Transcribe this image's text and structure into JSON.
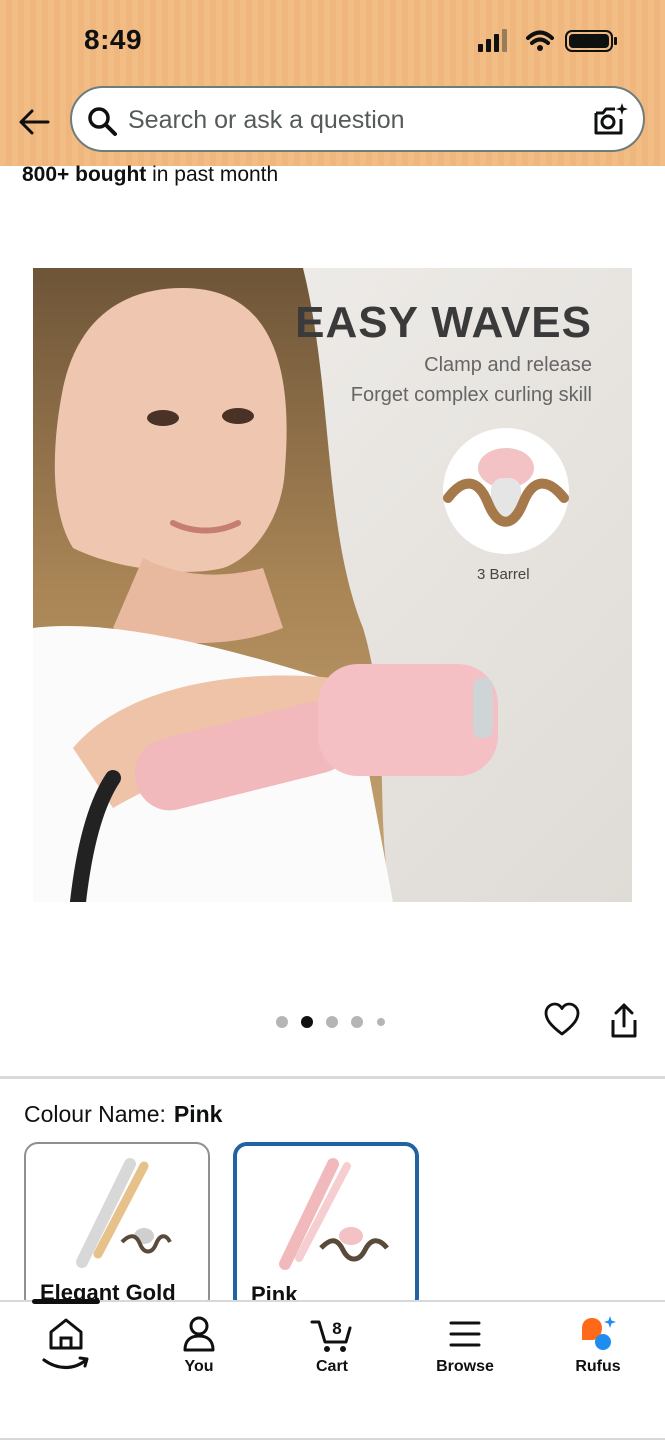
{
  "status_bar": {
    "time": "8:49"
  },
  "search": {
    "placeholder": "Search or ask a question"
  },
  "product": {
    "bought_count": "800+ bought",
    "bought_suffix": "in past month",
    "image": {
      "title": "EASY WAVES",
      "subtitle_1": "Clamp and release",
      "subtitle_2": "Forget complex curling skill",
      "badge": "3 Barrel"
    },
    "carousel": {
      "total": 5,
      "active_index": 1
    }
  },
  "colour": {
    "label": "Colour Name:",
    "selected": "Pink",
    "options": [
      {
        "name": "Elegant Gold",
        "selected": false
      },
      {
        "name": "Pink",
        "selected": true
      }
    ]
  },
  "bottom_nav": {
    "items": [
      {
        "label": "",
        "icon": "home-icon"
      },
      {
        "label": "You",
        "icon": "person-icon"
      },
      {
        "label": "Cart",
        "icon": "cart-icon",
        "badge": "8"
      },
      {
        "label": "Browse",
        "icon": "menu-icon"
      },
      {
        "label": "Rufus",
        "icon": "rufus-icon"
      }
    ]
  },
  "colors": {
    "header_bg": "#f2bd84",
    "selected_border": "#2162a1",
    "rufus_orange": "#ff6a1a",
    "rufus_blue": "#1f8cf0"
  }
}
